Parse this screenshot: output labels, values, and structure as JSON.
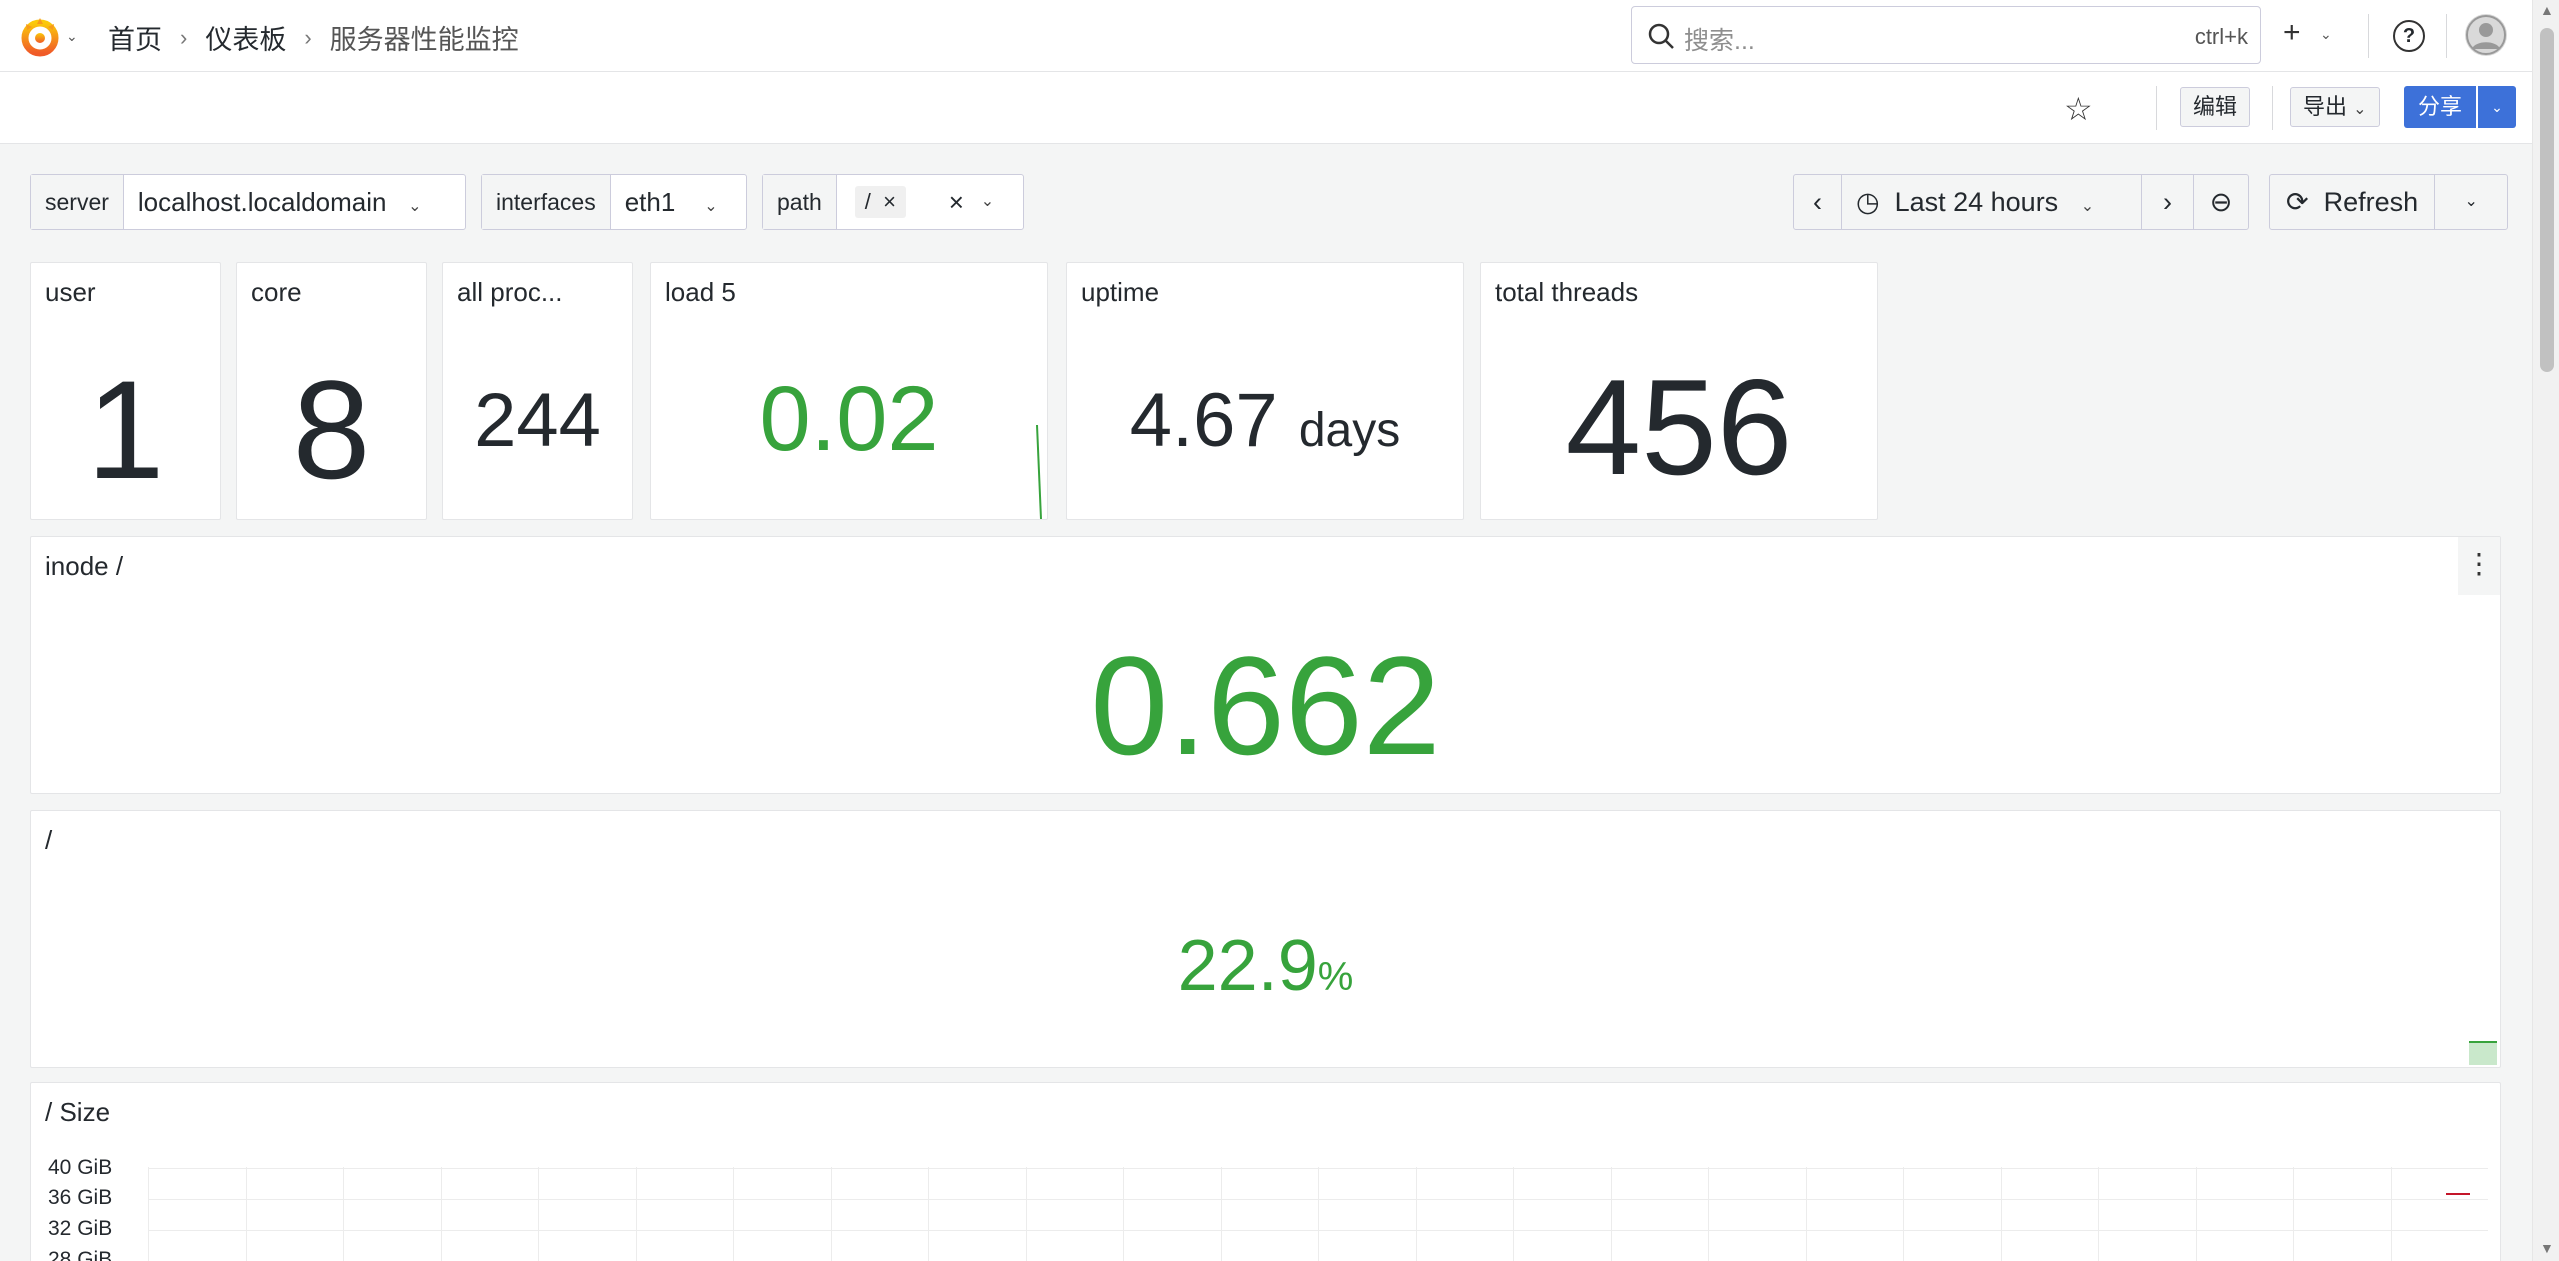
{
  "breadcrumbs": [
    "首页",
    "仪表板",
    "服务器性能监控"
  ],
  "search": {
    "placeholder": "搜索...",
    "shortcut": "ctrl+k"
  },
  "toolbar": {
    "edit_label": "编辑",
    "export_label": "导出",
    "share_label": "分享"
  },
  "variables": [
    {
      "label": "server",
      "value": "localhost.localdomain"
    },
    {
      "label": "interfaces",
      "value": "eth1"
    },
    {
      "label": "path",
      "value": "/"
    }
  ],
  "time": {
    "range_label": "Last 24 hours",
    "refresh_label": "Refresh"
  },
  "stats": [
    {
      "title": "user",
      "value": "1"
    },
    {
      "title": "core",
      "value": "8"
    },
    {
      "title": "all proc...",
      "value": "244"
    },
    {
      "title": "load 5",
      "value": "0.02"
    },
    {
      "title": "uptime",
      "value": "4.67",
      "unit": "days"
    },
    {
      "title": "total threads",
      "value": "456"
    }
  ],
  "inode_panel": {
    "title": "inode /",
    "value": "0.662"
  },
  "root_panel": {
    "title": "/",
    "value": "22.9",
    "unit": "%"
  },
  "size_panel": {
    "title": "/ Size",
    "y_ticks": [
      "40 GiB",
      "36 GiB",
      "32 GiB",
      "28 GiB"
    ]
  },
  "colors": {
    "green": "#37a33c",
    "primary": "#3d71d9",
    "red": "#c4162a"
  }
}
